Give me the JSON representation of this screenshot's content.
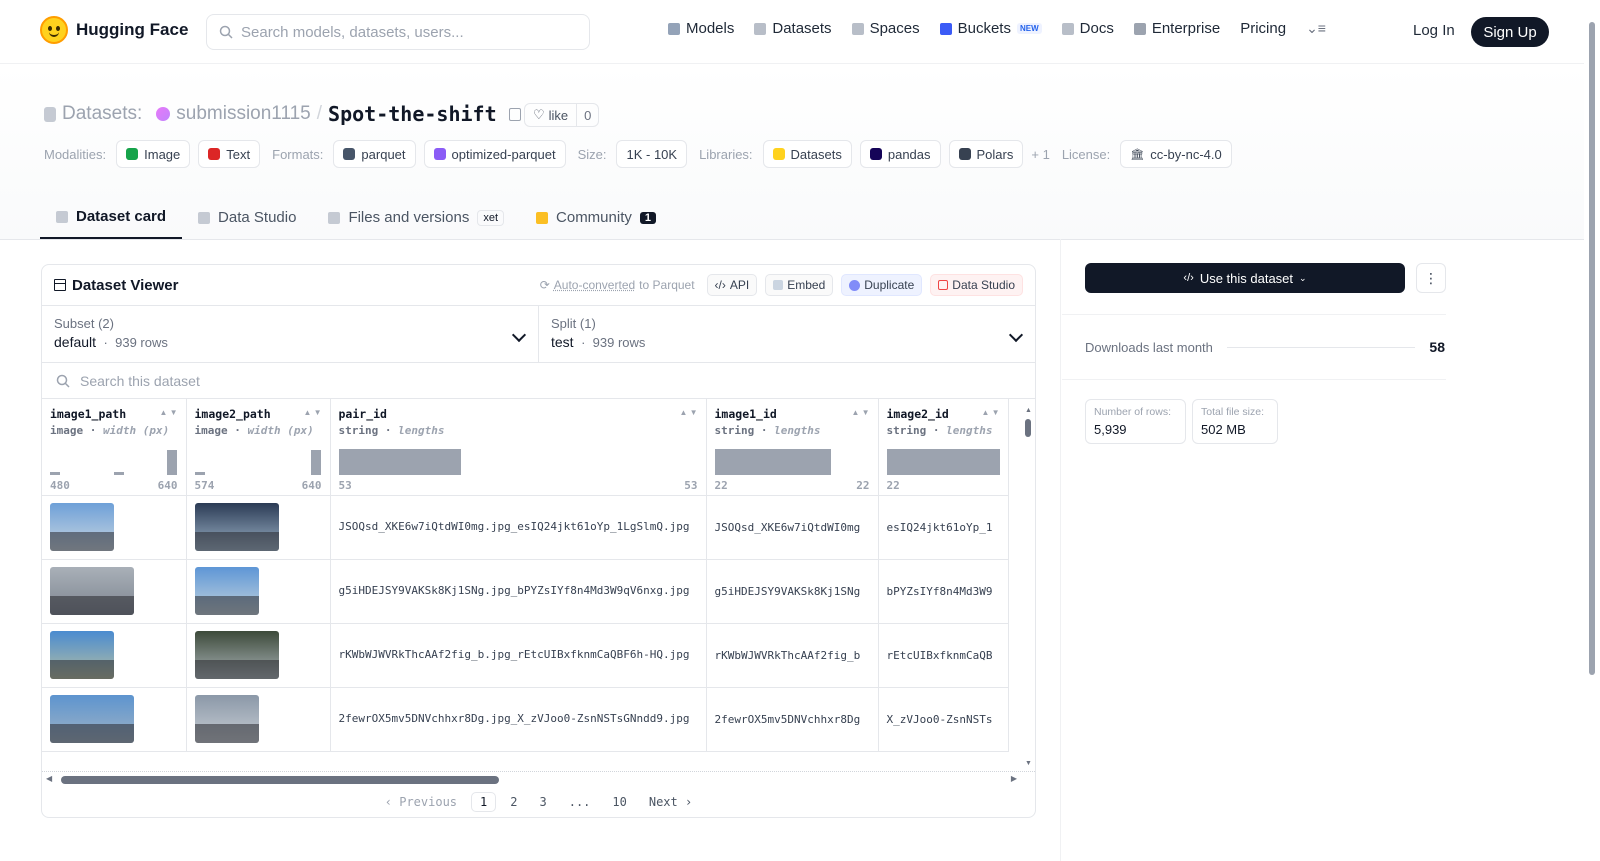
{
  "brand": "Hugging Face",
  "search_placeholder": "Search models, datasets, users...",
  "nav": [
    {
      "label": "Models",
      "icon": "cube-icon",
      "color": "#94a3b8"
    },
    {
      "label": "Datasets",
      "icon": "database-icon",
      "color": "#b8bec8"
    },
    {
      "label": "Spaces",
      "icon": "grid-icon",
      "color": "#b8bec8"
    },
    {
      "label": "Buckets",
      "icon": "bucket-icon",
      "color": "#3b5bf6",
      "badge": "NEW"
    },
    {
      "label": "Docs",
      "icon": "book-icon",
      "color": "#b8bec8"
    },
    {
      "label": "Enterprise",
      "icon": "enterprise-icon",
      "color": "#9ca3af"
    },
    {
      "label": "Pricing"
    }
  ],
  "auth": {
    "login": "Log In",
    "signup": "Sign Up"
  },
  "breadcrumb": {
    "type": "Datasets:",
    "user": "submission1115",
    "sep": "/",
    "name": "Spot-the-shift"
  },
  "like": {
    "label": "like",
    "count": "0"
  },
  "tags": {
    "modalities_label": "Modalities:",
    "modalities": [
      {
        "label": "Image",
        "color": "#16a34a"
      },
      {
        "label": "Text",
        "color": "#dc2626"
      }
    ],
    "formats_label": "Formats:",
    "formats": [
      {
        "label": "parquet",
        "color": "#475569"
      },
      {
        "label": "optimized-parquet",
        "color": "#8b5cf6"
      }
    ],
    "size_label": "Size:",
    "size": "1K - 10K",
    "libraries_label": "Libraries:",
    "libraries": [
      {
        "label": "Datasets",
        "color": "#ffd21e"
      },
      {
        "label": "pandas",
        "color": "#150458"
      },
      {
        "label": "Polars",
        "color": "#374151"
      }
    ],
    "libraries_more": "+ 1",
    "license_label": "License:",
    "license": "cc-by-nc-4.0"
  },
  "tabs": [
    {
      "label": "Dataset card",
      "active": true
    },
    {
      "label": "Data Studio"
    },
    {
      "label": "Files and versions",
      "extra": "xet"
    },
    {
      "label": "Community",
      "count": "1"
    }
  ],
  "viewer": {
    "title": "Dataset Viewer",
    "auto_converted_a": "Auto-converted",
    "auto_converted_b": "to Parquet",
    "buttons": [
      "API",
      "Embed",
      "Duplicate",
      "Data Studio"
    ],
    "subset": {
      "label": "Subset (2)",
      "value": "default",
      "rows": "939 rows"
    },
    "split": {
      "label": "Split (1)",
      "value": "test",
      "rows": "939 rows"
    },
    "search_placeholder": "Search this dataset",
    "columns": [
      {
        "name": "image1_path",
        "type": "image",
        "stat": "width (px)",
        "min": "480",
        "max": "640"
      },
      {
        "name": "image2_path",
        "type": "image",
        "stat": "width (px)",
        "min": "574",
        "max": "640"
      },
      {
        "name": "pair_id",
        "type": "string",
        "stat": "lengths",
        "min": "53",
        "max": "53"
      },
      {
        "name": "image1_id",
        "type": "string",
        "stat": "lengths",
        "min": "22",
        "max": "22"
      },
      {
        "name": "image2_id",
        "type": "string",
        "stat": "lengths",
        "min": "22",
        "max": ""
      }
    ],
    "rows": [
      {
        "pair_id": "JSOQsd_XKE6w7iQtdWI0mg.jpg_esIQ24jkt61oYp_1LgSlmQ.jpg",
        "image1_id": "JSOQsd_XKE6w7iQtdWI0mg",
        "image2_id": "esIQ24jkt61oYp_1",
        "t1": [
          "#6ea0d8",
          "#c9d6e0"
        ],
        "t2": [
          "#2b3b55",
          "#9eb4c8"
        ]
      },
      {
        "pair_id": "g5iHDEJSY9VAKSk8Kj1SNg.jpg_bPYZsIYf8n4Md3W9qV6nxg.jpg",
        "image1_id": "g5iHDEJSY9VAKSk8Kj1SNg",
        "image2_id": "bPYZsIYf8n4Md3W9",
        "t1": [
          "#a9b0b8",
          "#7d8590"
        ],
        "t2": [
          "#5e96d6",
          "#c4d4dd"
        ]
      },
      {
        "pair_id": "rKWbWJWVRkThcAAf2fig_b.jpg_rEtcUIBxfknmCaQBF6h-HQ.jpg",
        "image1_id": "rKWbWJWVRkThcAAf2fig_b",
        "image2_id": "rEtcUIBxfknmCaQB",
        "t1": [
          "#4a8bd0",
          "#b6bfa3"
        ],
        "t2": [
          "#3d4a3a",
          "#aab4b8"
        ]
      },
      {
        "pair_id": "2fewrOX5mv5DNVchhxr8Dg.jpg_X_zVJoo0-ZsnNSTsGNndd9.jpg",
        "image1_id": "2fewrOX5mv5DNVchhxr8Dg",
        "image2_id": "X_zVJoo0-ZsnNSTs",
        "t1": [
          "#5d94cf",
          "#9fb3c5"
        ],
        "t2": [
          "#8b98a8",
          "#c8ced4"
        ]
      }
    ],
    "pagination": [
      "Previous",
      "1",
      "2",
      "3",
      "...",
      "10",
      "Next"
    ]
  },
  "sidebar": {
    "use_button": "Use this dataset",
    "downloads_label": "Downloads last month",
    "downloads_value": "58",
    "stats": [
      {
        "label": "Number of rows:",
        "value": "5,939"
      },
      {
        "label": "Total file size:",
        "value": "502 MB"
      }
    ]
  },
  "histograms": [
    [
      0.12,
      0.12,
      0.96
    ],
    [
      0.1,
      0.96
    ],
    [
      1.0
    ],
    [
      1.0
    ],
    [
      1.0
    ]
  ]
}
